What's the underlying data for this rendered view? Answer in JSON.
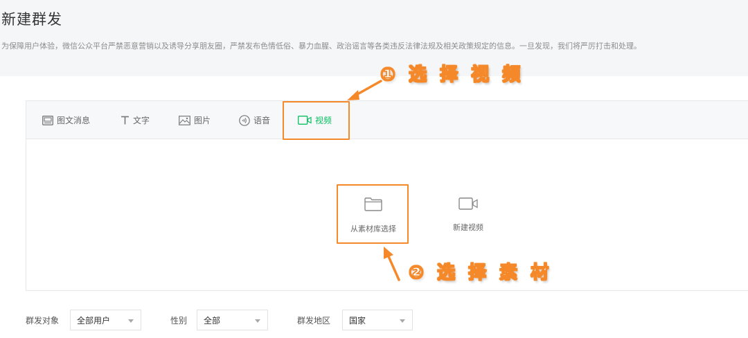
{
  "page": {
    "title": "新建群发",
    "notice": "为保障用户体验，微信公众平台严禁恶意营销以及诱导分享朋友圈，严禁发布色情低俗、暴力血腥、政治谣言等各类违反法律法规及相关政策规定的信息。一旦发现，我们将严厉打击和处理。"
  },
  "tabs": [
    {
      "label": "图文消息",
      "icon": "news-icon"
    },
    {
      "label": "文字",
      "icon": "text-icon"
    },
    {
      "label": "图片",
      "icon": "image-icon"
    },
    {
      "label": "语音",
      "icon": "voice-icon"
    },
    {
      "label": "视频",
      "icon": "video-icon",
      "active": true
    }
  ],
  "video_options": [
    {
      "label": "从素材库选择",
      "icon": "folder-icon"
    },
    {
      "label": "新建视频",
      "icon": "video-camera-icon"
    }
  ],
  "annotations": {
    "step1": "① 选 择 视 频",
    "step2": "② 选 择 素 材"
  },
  "filters": {
    "target_label": "群发对象",
    "target_value": "全部用户",
    "gender_label": "性别",
    "gender_value": "全部",
    "region_label": "群发地区",
    "region_value": "国家"
  },
  "colors": {
    "accent": "#07c160",
    "annotation": "#f5892a"
  }
}
